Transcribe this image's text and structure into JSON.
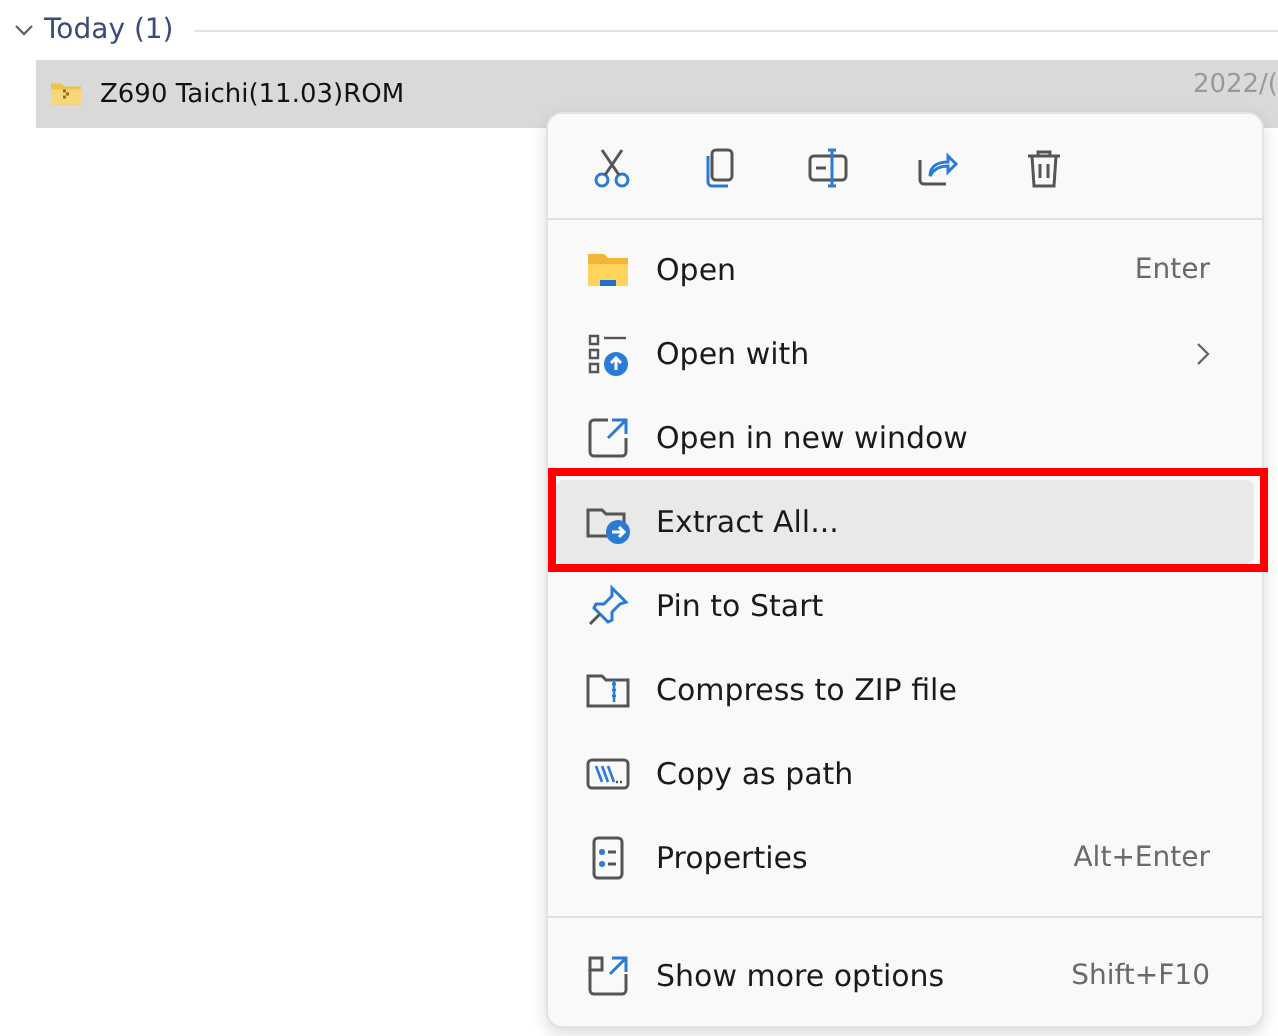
{
  "group": {
    "label": "Today (1)",
    "expanded": true
  },
  "file": {
    "name": "Z690 Taichi(11.03)ROM",
    "date": "2022/(",
    "selected": true
  },
  "context_menu": {
    "toolbar": [
      {
        "kind": "cut"
      },
      {
        "kind": "copy"
      },
      {
        "kind": "rename"
      },
      {
        "kind": "share"
      },
      {
        "kind": "delete"
      }
    ],
    "sections": [
      {
        "items": [
          {
            "kind": "folder",
            "label": "Open",
            "shortcut": "Enter",
            "submenu": false,
            "selected": false,
            "outlined": false
          },
          {
            "kind": "openwith",
            "label": "Open with",
            "submenu": true,
            "selected": false,
            "outlined": false
          },
          {
            "kind": "newwindow",
            "label": "Open in new window",
            "submenu": false,
            "selected": false,
            "outlined": false
          },
          {
            "kind": "extract",
            "label": "Extract All...",
            "submenu": false,
            "selected": true,
            "outlined": true
          },
          {
            "kind": "pin",
            "label": "Pin to Start",
            "submenu": false,
            "selected": false,
            "outlined": false
          },
          {
            "kind": "zip",
            "label": "Compress to ZIP file",
            "submenu": false,
            "selected": false,
            "outlined": false
          },
          {
            "kind": "path",
            "label": "Copy as path",
            "submenu": false,
            "selected": false,
            "outlined": false
          },
          {
            "kind": "properties",
            "label": "Properties",
            "shortcut": "Alt+Enter",
            "submenu": false,
            "selected": false,
            "outlined": false
          }
        ]
      },
      {
        "items": [
          {
            "kind": "more",
            "label": "Show more options",
            "shortcut": "Shift+F10",
            "submenu": false,
            "selected": false,
            "outlined": false
          }
        ]
      }
    ]
  }
}
